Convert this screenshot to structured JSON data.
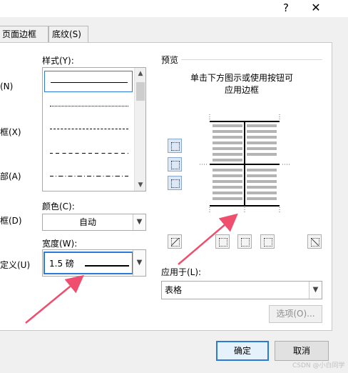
{
  "window": {
    "help": "?",
    "close": "✕"
  },
  "tabs": [
    {
      "label": "页面边框(P)"
    },
    {
      "label": "底纹(S)"
    }
  ],
  "settings_partial": [
    {
      "label": "(N)"
    },
    {
      "label": "框(X)"
    },
    {
      "label": "部(A)"
    },
    {
      "label": "框(D)"
    },
    {
      "label": "定义(U)"
    }
  ],
  "style": {
    "label": "样式(Y):",
    "items": [
      "solid",
      "dotted",
      "dashed-fine",
      "dashed",
      "dash-dot"
    ],
    "selected": "solid"
  },
  "color": {
    "label": "颜色(C):",
    "value": "自动"
  },
  "width": {
    "label": "宽度(W):",
    "value": "1.5 磅"
  },
  "preview": {
    "label": "预览",
    "hint_line1": "单击下方图示或使用按钮可",
    "hint_line2": "应用边框"
  },
  "apply_to": {
    "label": "应用于(L):",
    "value": "表格"
  },
  "buttons": {
    "options": "选项(O)...",
    "ok": "确定",
    "cancel": "取消"
  },
  "watermark": "CSDN @小白同学",
  "colors": {
    "accent": "#2b7ad6",
    "arrow": "#f04e6e",
    "panel": "#ffffff",
    "dialog": "#f0f0f0"
  }
}
